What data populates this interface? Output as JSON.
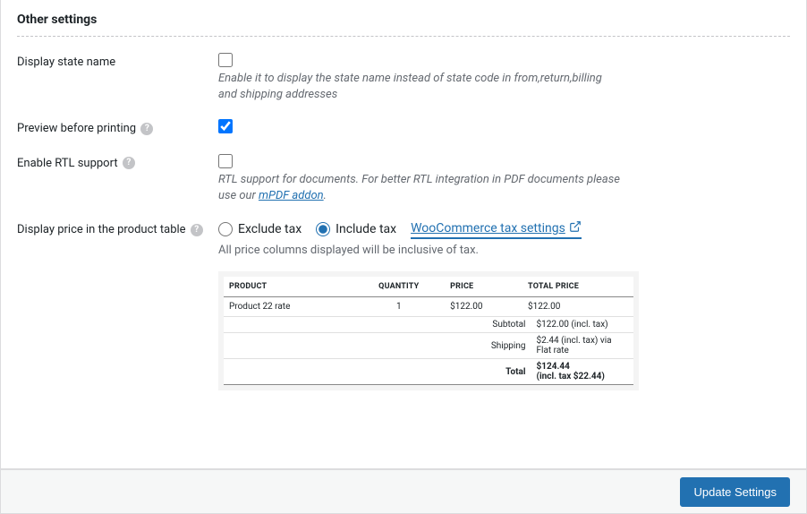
{
  "section_title": "Other settings",
  "rows": {
    "state_name": {
      "label": "Display state name",
      "checked": false,
      "desc": "Enable it to display the state name instead of state code in from,return,billing and shipping addresses"
    },
    "preview": {
      "label": "Preview before printing",
      "checked": true
    },
    "rtl": {
      "label": "Enable RTL support",
      "checked": false,
      "desc_pre": "RTL support for documents. For better RTL integration in PDF documents please use our ",
      "link_text": "mPDF addon",
      "desc_post": "."
    },
    "tax": {
      "label": "Display price in the product table",
      "options": {
        "exclude": "Exclude tax",
        "include": "Include tax"
      },
      "selected": "include",
      "ext_link": "WooCommerce tax settings",
      "desc": "All price columns displayed will be inclusive of tax."
    }
  },
  "preview_table": {
    "headers": {
      "product": "PRODUCT",
      "qty": "QUANTITY",
      "price": "PRICE",
      "total": "TOTAL PRICE"
    },
    "row": {
      "product": "Product 22 rate",
      "qty": "1",
      "price": "$122.00",
      "total": "$122.00"
    },
    "totals": {
      "subtotal_label": "Subtotal",
      "subtotal_value": "$122.00 (incl. tax)",
      "shipping_label": "Shipping",
      "shipping_value": "$2.44 (incl. tax) via Flat rate",
      "total_label": "Total",
      "total_value_line1": "$124.44",
      "total_value_line2": "(incl. tax $22.44)"
    }
  },
  "footer": {
    "update_btn": "Update Settings"
  }
}
